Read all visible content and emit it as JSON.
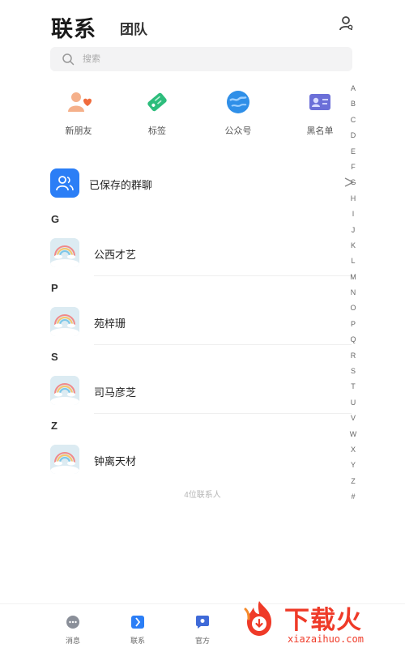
{
  "header": {
    "title": "联系",
    "team_tab": "团队",
    "profile_icon": "person-icon"
  },
  "search": {
    "placeholder": "搜索"
  },
  "shortcuts": [
    {
      "label": "新朋友",
      "icon": "new-friend-icon",
      "color": "#f06b3c"
    },
    {
      "label": "标签",
      "icon": "tag-icon",
      "color": "#2dbd7c"
    },
    {
      "label": "公众号",
      "icon": "official-account-icon",
      "color": "#2f8fe8"
    },
    {
      "label": "黑名单",
      "icon": "blacklist-icon",
      "color": "#6b6fd8"
    }
  ],
  "saved_groups": {
    "label": "已保存的群聊",
    "icon": "group-icon",
    "color": "#2b7ef6"
  },
  "sections": [
    {
      "letter": "G",
      "contacts": [
        {
          "name": "公西才艺"
        }
      ]
    },
    {
      "letter": "P",
      "contacts": [
        {
          "name": "苑梓珊"
        }
      ]
    },
    {
      "letter": "S",
      "contacts": [
        {
          "name": "司马彦芝"
        }
      ]
    },
    {
      "letter": "Z",
      "contacts": [
        {
          "name": "钟离天材"
        }
      ]
    }
  ],
  "contact_count": "4位联系人",
  "index_letters": [
    "A",
    "B",
    "C",
    "D",
    "E",
    "F",
    "G",
    "H",
    "I",
    "J",
    "K",
    "L",
    "M",
    "N",
    "O",
    "P",
    "Q",
    "R",
    "S",
    "T",
    "U",
    "V",
    "W",
    "X",
    "Y",
    "Z",
    "#"
  ],
  "tabbar": [
    {
      "label": "消息",
      "icon": "message-icon",
      "active": false
    },
    {
      "label": "联系",
      "icon": "contacts-icon",
      "active": true
    },
    {
      "label": "官方",
      "icon": "official-icon",
      "active": false
    }
  ],
  "watermark": {
    "text": "下载火",
    "url": "xiazaihuo.com"
  },
  "colors": {
    "accent": "#2b7ef6",
    "watermark": "#ef3a28"
  }
}
